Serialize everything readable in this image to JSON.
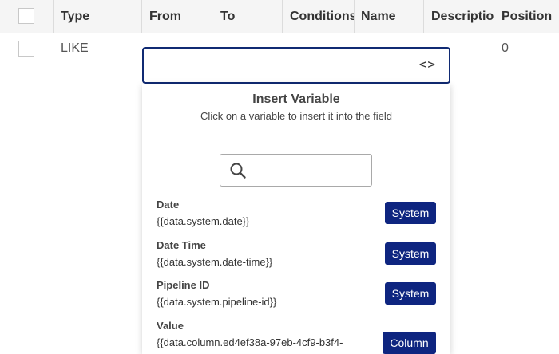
{
  "table": {
    "columns": [
      "Type",
      "From",
      "To",
      "Conditions",
      "Name",
      "Descriptior",
      "Position"
    ],
    "rows": [
      {
        "type": "LIKE",
        "position": "0"
      }
    ]
  },
  "insert_variable": {
    "title": "Insert Variable",
    "subtitle": "Click on a variable to insert it into the field",
    "search_placeholder": "",
    "variables": [
      {
        "name": "Date",
        "path": "{{data.system.date}}",
        "tag": "System"
      },
      {
        "name": "Date Time",
        "path": "{{data.system.date-time}}",
        "tag": "System"
      },
      {
        "name": "Pipeline ID",
        "path": "{{data.system.pipeline-id}}",
        "tag": "System"
      },
      {
        "name": "Value",
        "path": "{{data.column.ed4ef38a-97eb-4cf9-b3f4-",
        "tag": "Column"
      }
    ]
  },
  "icons": {
    "field_toggle": "code-icon",
    "search": "search-icon"
  },
  "colors": {
    "accent": "#102a73",
    "tag_bg": "#0e2580"
  }
}
